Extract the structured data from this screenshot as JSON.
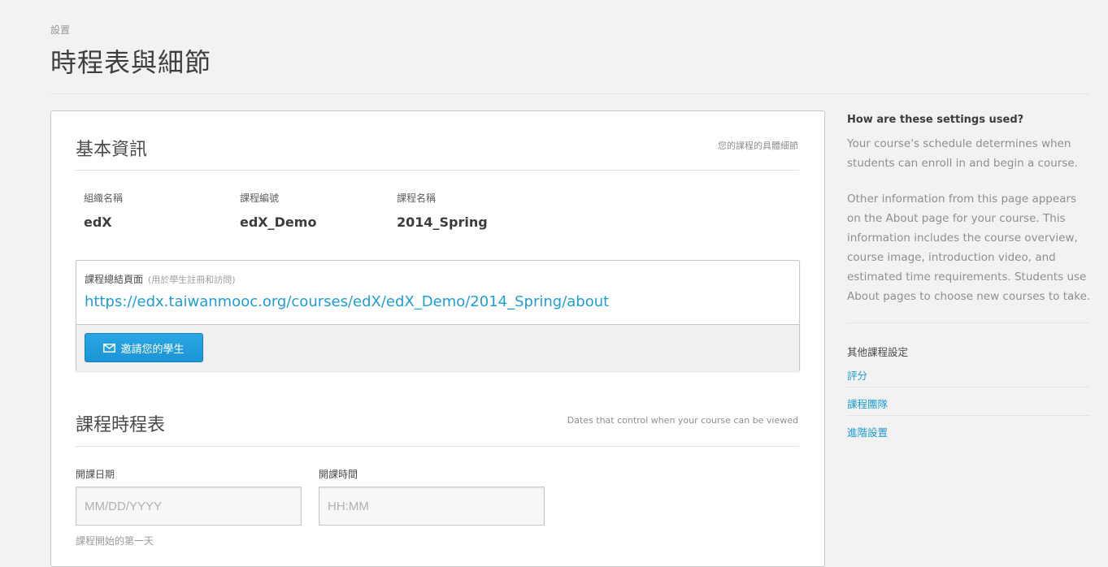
{
  "header": {
    "subtitle": "設置",
    "title": "時程表與細節"
  },
  "basic_info": {
    "title": "基本資訊",
    "description": "您的課程的具體細節",
    "fields": [
      {
        "label": "組織名稱",
        "value": "edX"
      },
      {
        "label": "課程編號",
        "value": "edX_Demo"
      },
      {
        "label": "課程名稱",
        "value": "2014_Spring"
      }
    ],
    "summary_page": {
      "label": "課程總結頁面",
      "hint": "(用於學生註冊和訪問)",
      "url": "https://edx.taiwanmooc.org/courses/edX/edX_Demo/2014_Spring/about",
      "invite_button": "邀請您的學生",
      "invite_icon": "envelope-icon"
    }
  },
  "schedule": {
    "title": "課程時程表",
    "description": "Dates that control when your course can be viewed",
    "start_date": {
      "label": "開課日期",
      "placeholder": "MM/DD/YYYY"
    },
    "start_time": {
      "label": "開課時間",
      "placeholder": "HH:MM"
    },
    "footnote": "課程開始的第一天"
  },
  "sidebar": {
    "heading": "How are these settings used?",
    "paragraph1": "Your course's schedule determines when students can enroll in and begin a course.",
    "paragraph2": "Other information from this page appears on the About page for your course. This information includes the course overview, course image, introduction video, and estimated time requirements. Students use About pages to choose new courses to take.",
    "other_settings_title": "其他課程設定",
    "links": [
      "評分",
      "課程團隊",
      "進階設置"
    ]
  },
  "colors": {
    "accent": "#1d9dd9",
    "background": "#f2f2f2"
  }
}
